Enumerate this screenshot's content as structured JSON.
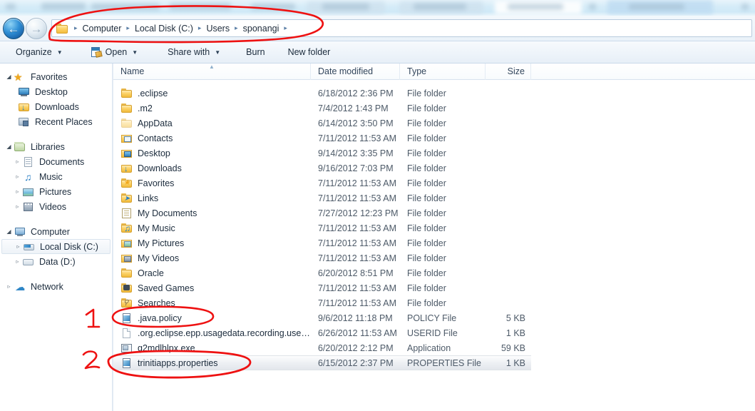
{
  "window": {
    "title": "sponangi",
    "blurred_top_strip": true
  },
  "nav": {
    "back_icon": "back-arrow-icon",
    "forward_icon": "forward-arrow-icon",
    "folder_icon": "folder-icon",
    "breadcrumbs": [
      "Computer",
      "Local Disk (C:)",
      "Users",
      "sponangi"
    ],
    "separator": "▸"
  },
  "toolbar": {
    "items": [
      {
        "label": "Organize",
        "caret": true,
        "icon": null
      },
      {
        "label": "Open",
        "caret": true,
        "icon": "open-file-icon"
      },
      {
        "label": "Share with",
        "caret": true,
        "icon": null
      },
      {
        "label": "Burn",
        "caret": false,
        "icon": null
      },
      {
        "label": "New folder",
        "caret": false,
        "icon": null
      }
    ],
    "caret_glyph": "▼"
  },
  "sidebar": {
    "groups": [
      {
        "header": {
          "label": "Favorites",
          "icon": "star-icon",
          "expander": "expanded"
        },
        "items": [
          {
            "label": "Desktop",
            "icon": "monitor-icon",
            "expander": "none"
          },
          {
            "label": "Downloads",
            "icon": "downloads-folder-icon",
            "expander": "none"
          },
          {
            "label": "Recent Places",
            "icon": "recent-places-icon",
            "expander": "none"
          }
        ]
      },
      {
        "header": {
          "label": "Libraries",
          "icon": "library-icon",
          "expander": "expanded"
        },
        "items": [
          {
            "label": "Documents",
            "icon": "documents-icon",
            "expander": "collapsed"
          },
          {
            "label": "Music",
            "icon": "music-icon",
            "expander": "collapsed"
          },
          {
            "label": "Pictures",
            "icon": "pictures-icon",
            "expander": "collapsed"
          },
          {
            "label": "Videos",
            "icon": "videos-icon",
            "expander": "collapsed"
          }
        ]
      },
      {
        "header": {
          "label": "Computer",
          "icon": "computer-icon",
          "expander": "expanded"
        },
        "items": [
          {
            "label": "Local Disk (C:)",
            "icon": "hard-drive-icon",
            "expander": "collapsed",
            "selected": true
          },
          {
            "label": "Data (D:)",
            "icon": "hard-drive-icon",
            "expander": "collapsed"
          }
        ]
      },
      {
        "header": {
          "label": "Network",
          "icon": "network-icon",
          "expander": "collapsed"
        },
        "items": []
      }
    ],
    "expander_collapsed_glyph": "▹",
    "expander_expanded_glyph": "◢"
  },
  "filelist": {
    "columns": [
      {
        "key": "name",
        "label": "Name",
        "sorted": true,
        "sort_glyph": "▲"
      },
      {
        "key": "date",
        "label": "Date modified"
      },
      {
        "key": "type",
        "label": "Type"
      },
      {
        "key": "size",
        "label": "Size"
      }
    ],
    "rows": [
      {
        "name": ".eclipse",
        "date": "6/18/2012 2:36 PM",
        "type": "File folder",
        "size": "",
        "icon": "folder-icon"
      },
      {
        "name": ".m2",
        "date": "7/4/2012 1:43 PM",
        "type": "File folder",
        "size": "",
        "icon": "folder-icon"
      },
      {
        "name": "AppData",
        "date": "6/14/2012 3:50 PM",
        "type": "File folder",
        "size": "",
        "icon": "folder-icon-hidden"
      },
      {
        "name": "Contacts",
        "date": "7/11/2012 11:53 AM",
        "type": "File folder",
        "size": "",
        "icon": "contacts-folder-icon"
      },
      {
        "name": "Desktop",
        "date": "9/14/2012 3:35 PM",
        "type": "File folder",
        "size": "",
        "icon": "desktop-folder-icon"
      },
      {
        "name": "Downloads",
        "date": "9/16/2012 7:03 PM",
        "type": "File folder",
        "size": "",
        "icon": "downloads-folder-icon"
      },
      {
        "name": "Favorites",
        "date": "7/11/2012 11:53 AM",
        "type": "File folder",
        "size": "",
        "icon": "favorites-folder-icon"
      },
      {
        "name": "Links",
        "date": "7/11/2012 11:53 AM",
        "type": "File folder",
        "size": "",
        "icon": "links-folder-icon"
      },
      {
        "name": "My Documents",
        "date": "7/27/2012 12:23 PM",
        "type": "File folder",
        "size": "",
        "icon": "documents-folder-icon"
      },
      {
        "name": "My Music",
        "date": "7/11/2012 11:53 AM",
        "type": "File folder",
        "size": "",
        "icon": "music-folder-icon"
      },
      {
        "name": "My Pictures",
        "date": "7/11/2012 11:53 AM",
        "type": "File folder",
        "size": "",
        "icon": "pictures-folder-icon"
      },
      {
        "name": "My Videos",
        "date": "7/11/2012 11:53 AM",
        "type": "File folder",
        "size": "",
        "icon": "videos-folder-icon"
      },
      {
        "name": "Oracle",
        "date": "6/20/2012 8:51 PM",
        "type": "File folder",
        "size": "",
        "icon": "folder-icon"
      },
      {
        "name": "Saved Games",
        "date": "7/11/2012 11:53 AM",
        "type": "File folder",
        "size": "",
        "icon": "saved-games-folder-icon"
      },
      {
        "name": "Searches",
        "date": "7/11/2012 11:53 AM",
        "type": "File folder",
        "size": "",
        "icon": "searches-folder-icon"
      },
      {
        "name": ".java.policy",
        "date": "9/6/2012 11:18 PM",
        "type": "POLICY File",
        "size": "5 KB",
        "icon": "properties-file-icon"
      },
      {
        "name": ".org.eclipse.epp.usagedata.recording.use…",
        "date": "6/26/2012 11:53 AM",
        "type": "USERID File",
        "size": "1 KB",
        "icon": "blank-file-icon"
      },
      {
        "name": "g2mdlhlpx.exe",
        "date": "6/20/2012 2:12 PM",
        "type": "Application",
        "size": "59 KB",
        "icon": "application-icon"
      },
      {
        "name": "trinitiapps.properties",
        "date": "6/15/2012 2:37 PM",
        "type": "PROPERTIES File",
        "size": "1 KB",
        "icon": "properties-file-icon",
        "selected": true
      }
    ]
  },
  "annotations": {
    "color": "#ee1111",
    "marks": [
      {
        "type": "ellipse",
        "target": "breadcrumb-bar",
        "label": ""
      },
      {
        "type": "number",
        "label": "1",
        "target": ".java.policy"
      },
      {
        "type": "ellipse",
        "target": ".java.policy",
        "label": ""
      },
      {
        "type": "number",
        "label": "2",
        "target": "trinitiapps.properties"
      },
      {
        "type": "ellipse",
        "target": "trinitiapps.properties",
        "label": ""
      }
    ]
  }
}
